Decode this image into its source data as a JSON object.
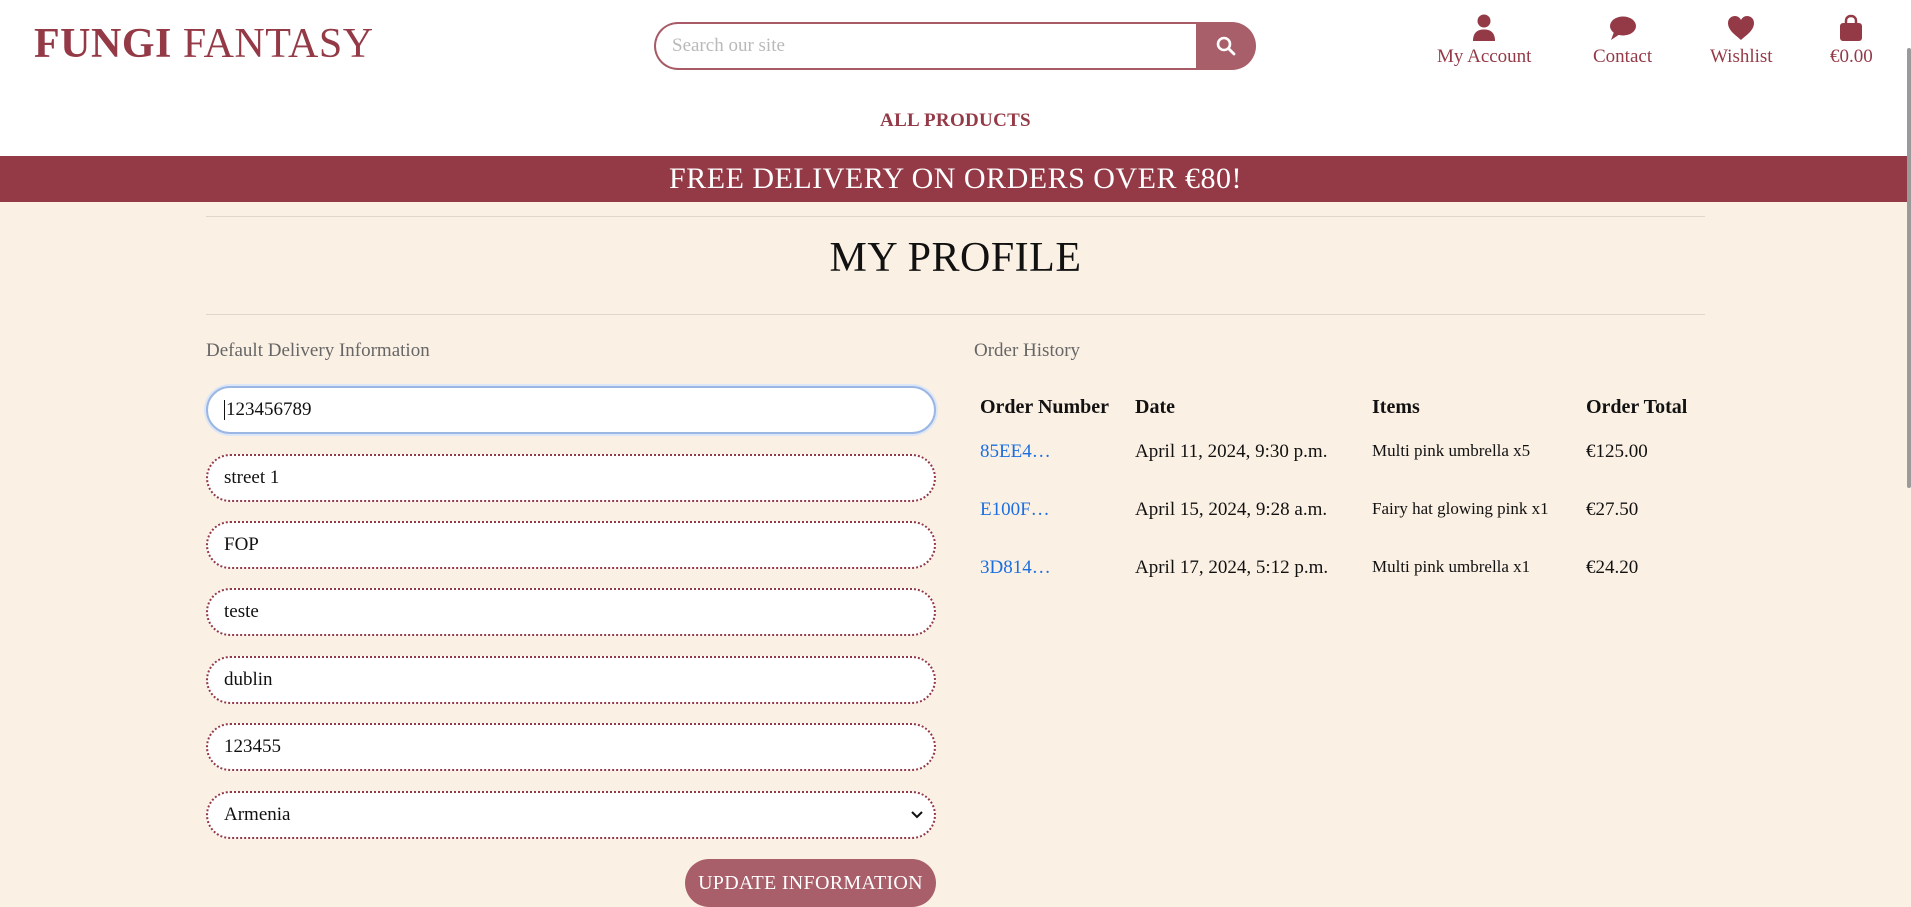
{
  "brand": {
    "part1": "FUNGI",
    "part2": "FANTASY"
  },
  "search": {
    "placeholder": "Search our site"
  },
  "nav": {
    "account": "My Account",
    "contact": "Contact",
    "wishlist": "Wishlist",
    "bag": "€0.00"
  },
  "menu": {
    "all_products": "ALL PRODUCTS"
  },
  "banner": "FREE DELIVERY ON ORDERS OVER €80!",
  "page_title": "MY PROFILE",
  "delivery": {
    "heading": "Default Delivery Information",
    "fields": [
      "123456789",
      "street 1",
      "FOP",
      "teste",
      "dublin",
      "123455"
    ],
    "country": "Armenia",
    "button": "UPDATE INFORMATION"
  },
  "orders": {
    "heading": "Order History",
    "columns": [
      "Order Number",
      "Date",
      "Items",
      "Order Total"
    ],
    "rows": [
      {
        "number": "85EE4…",
        "date": "April 11, 2024, 9:30 p.m.",
        "items": "Multi pink umbrella x5",
        "total": "€125.00"
      },
      {
        "number": "E100F…",
        "date": "April 15, 2024, 9:28 a.m.",
        "items": "Fairy hat glowing pink x1",
        "total": "€27.50"
      },
      {
        "number": "3D814…",
        "date": "April 17, 2024, 5:12 p.m.",
        "items": "Multi pink umbrella x1",
        "total": "€24.20"
      }
    ]
  },
  "colors": {
    "brand": "#943a47",
    "button": "#a85f6a",
    "background": "#fbf0e4",
    "link": "#1b6fe0"
  }
}
